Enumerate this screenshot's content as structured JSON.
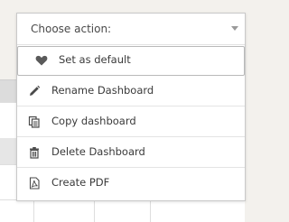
{
  "dropdown": {
    "placeholder": "Choose action:",
    "items": [
      {
        "label": "Set as default",
        "icon": "heart-icon",
        "highlighted": true
      },
      {
        "label": "Rename Dashboard",
        "icon": "pencil-icon"
      },
      {
        "label": "Copy dashboard",
        "icon": "copy-icon"
      },
      {
        "label": "Delete Dashboard",
        "icon": "trash-icon"
      },
      {
        "label": "Create PDF",
        "icon": "pdf-icon"
      }
    ]
  },
  "colors": {
    "border": "#c9c9c9",
    "text": "#3a3a3a",
    "page_background": "#f3f1ed"
  }
}
